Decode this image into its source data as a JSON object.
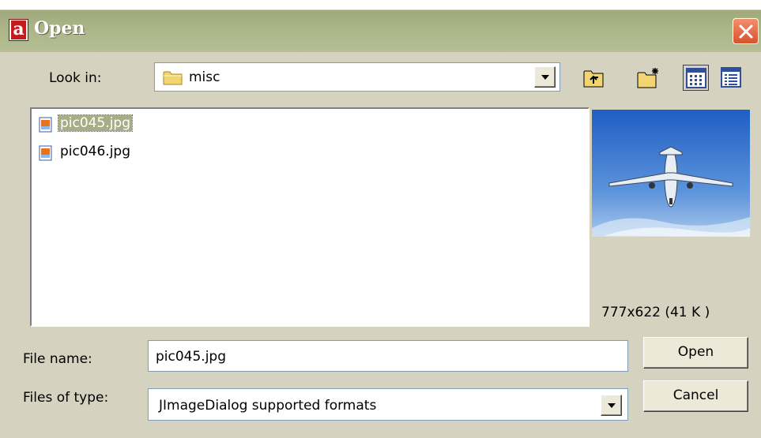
{
  "window": {
    "title": "Open",
    "app_icon_letter": "a"
  },
  "look_in": {
    "label": "Look in:",
    "value": "misc"
  },
  "files": [
    {
      "name": "pic045.jpg",
      "selected": true
    },
    {
      "name": "pic046.jpg",
      "selected": false
    }
  ],
  "preview": {
    "info": "777x622 (41 K )"
  },
  "file_name": {
    "label": "File name:",
    "value": "pic045.jpg"
  },
  "file_type": {
    "label": "Files of type:",
    "value": "JImageDialog supported formats"
  },
  "buttons": {
    "open": "Open",
    "cancel": "Cancel"
  },
  "toolbar_icons": [
    "up-one-level-icon",
    "new-folder-icon",
    "list-view-icon",
    "details-view-icon"
  ],
  "colors": {
    "titlebar": "#aab487",
    "selection": "#a6ad87",
    "close": "#d9512c",
    "dialog": "#d6d2c0"
  }
}
